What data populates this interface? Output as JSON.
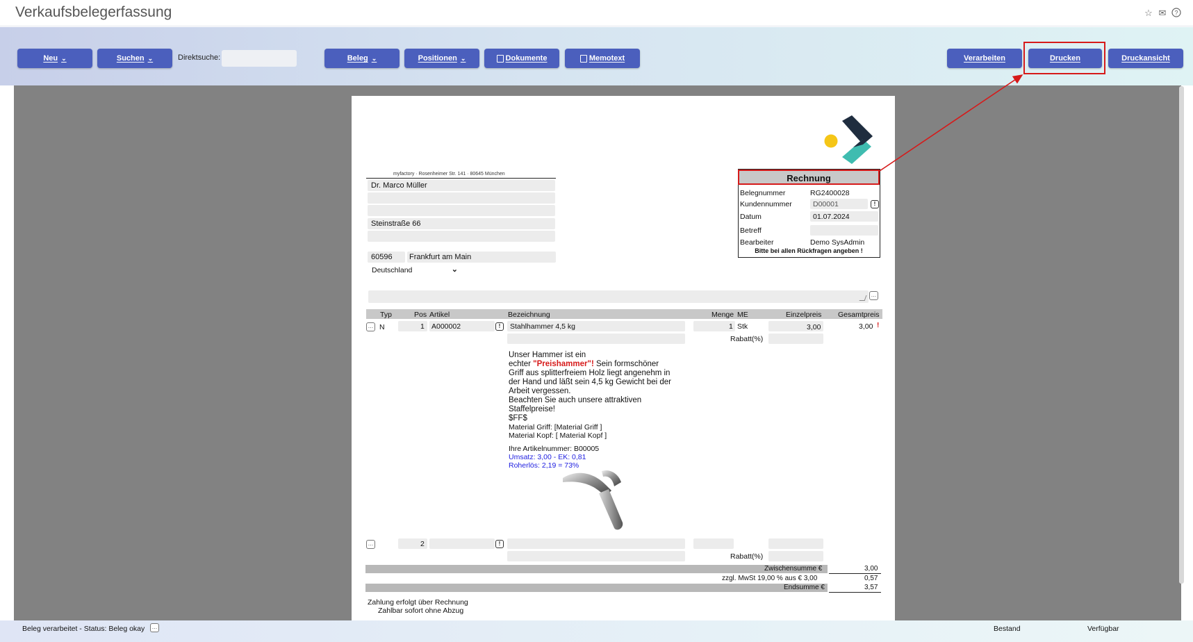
{
  "window": {
    "title": "Verkaufsbelegerfassung",
    "icons": [
      "star-icon",
      "mail-icon",
      "help-icon"
    ]
  },
  "toolbar": {
    "neu": "Neu",
    "suchen": "Suchen",
    "direktsuche_label": "Direktsuche:",
    "direktsuche_value": "",
    "beleg": "Beleg",
    "positionen": "Positionen",
    "dokumente": "Dokumente",
    "memotext": "Memotext",
    "verarbeiten": "Verarbeiten",
    "drucken": "Drucken",
    "druckansicht": "Druckansicht"
  },
  "document": {
    "sender_line": "myfactory · Rosenheimer Str. 141 · 80645 München",
    "recipient": {
      "name": "Dr. Marco Müller",
      "line2": "",
      "line3": "",
      "street": "Steinstraße 66",
      "line5": "",
      "zip": "60596",
      "city": "Frankfurt am Main",
      "country": "Deutschland"
    },
    "invoice_box": {
      "title": "Rechnung",
      "labels": {
        "belegnummer": "Belegnummer",
        "kundennummer": "Kundennummer",
        "datum": "Datum",
        "betreff": "Betreff",
        "bearbeiter": "Bearbeiter"
      },
      "values": {
        "belegnummer": "RG2400028",
        "kundennummer": "D00001",
        "datum": "01.07.2024",
        "betreff": "",
        "bearbeiter": "Demo SysAdmin"
      },
      "note": "Bitte bei allen Rückfragen angeben !"
    },
    "table": {
      "headers": [
        "Typ",
        "Pos",
        "Artikel",
        "Bezeichnung",
        "Menge",
        "ME",
        "Einzelpreis",
        "Gesamtpreis"
      ],
      "row1": {
        "typ": "N",
        "pos": "1",
        "artikel": "A000002",
        "bezeichnung": "Stahlhammer 4,5 kg",
        "menge": "1",
        "me": "Stk",
        "einzelpreis": "3,00",
        "gesamtpreis": "3,00",
        "rabatt_label": "Rabatt(%)",
        "text_lines": [
          "Unser Hammer ist ein",
          "echter ",
          "\"Preishammer\"!",
          " Sein formschöner",
          "Griff aus splitterfreiem Holz liegt angenehm in",
          "der Hand und läßt sein 4,5 kg Gewicht bei der",
          "Arbeit vergessen.",
          "Beachten Sie auch unsere attraktiven",
          "Staffelpreise!",
          "$FF$",
          "Material Griff: [Material Griff ]",
          "Material Kopf: [ Material Kopf ]",
          "Ihre Artikelnummer: B00005",
          "Umsatz: 3,00 - EK: 0,81",
          "Roherlös: 2,19 = 73%"
        ]
      },
      "row2": {
        "pos": "2",
        "rabatt_label": "Rabatt(%)"
      }
    },
    "totals": {
      "zwischensumme_label": "Zwischensumme €",
      "zwischensumme": "3,00",
      "mwst_label": "zzgl. MwSt 19,00 % aus € 3,00",
      "mwst": "0,57",
      "endsumme_label": "Endsumme €",
      "endsumme": "3,57"
    },
    "footer": {
      "line1": "Zahlung erfolgt über Rechnung",
      "line2": "Zahlbar sofort ohne Abzug"
    },
    "colors": {
      "logo_yellow": "#f5c617",
      "logo_dark": "#1f2d3f",
      "logo_teal": "#3fbcb0",
      "highlight_red": "#d61a1a",
      "blue_text": "#2020e0"
    }
  },
  "status": {
    "text": "Beleg verarbeitet - Status: Beleg okay",
    "bestand": "Bestand",
    "verfuegbar": "Verfügbar"
  }
}
